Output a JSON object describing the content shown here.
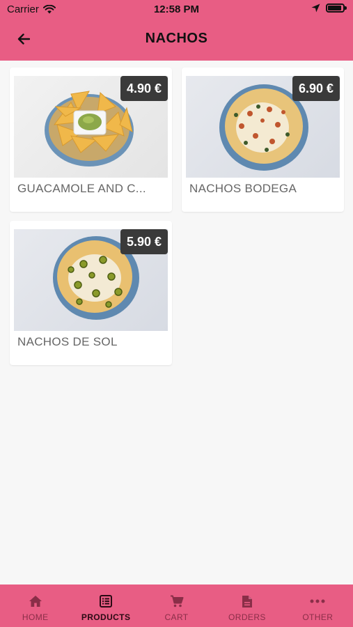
{
  "status": {
    "carrier": "Carrier",
    "time": "12:58 PM"
  },
  "header": {
    "title": "NACHOS",
    "back_icon": "arrow-left-icon"
  },
  "products": [
    {
      "name": "GUACAMOLE AND C...",
      "price": "4.90 €"
    },
    {
      "name": "NACHOS BODEGA",
      "price": "6.90 €"
    },
    {
      "name": "NACHOS DE SOL",
      "price": "5.90 €"
    }
  ],
  "tabs": [
    {
      "label": "HOME",
      "icon": "home-icon",
      "active": false
    },
    {
      "label": "PRODUCTS",
      "icon": "list-icon",
      "active": true
    },
    {
      "label": "CART",
      "icon": "cart-icon",
      "active": false
    },
    {
      "label": "ORDERS",
      "icon": "document-icon",
      "active": false
    },
    {
      "label": "OTHER",
      "icon": "more-icon",
      "active": false
    }
  ],
  "colors": {
    "brand": "#e85d84",
    "background": "#f7f7f7",
    "badge": "#3a3a3a"
  }
}
